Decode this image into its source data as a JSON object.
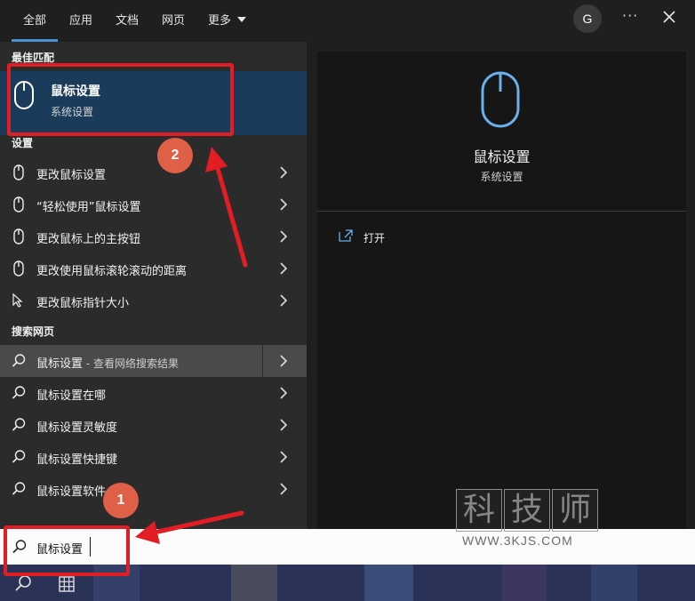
{
  "tabs": [
    {
      "label": "全部"
    },
    {
      "label": "应用"
    },
    {
      "label": "文档"
    },
    {
      "label": "网页"
    },
    {
      "label": "更多"
    }
  ],
  "user_avatar": "G",
  "more_menu": "···",
  "sections": {
    "best_match": "最佳匹配",
    "settings": "设置",
    "web": "搜索网页"
  },
  "best_match": {
    "title": "鼠标设置",
    "subtitle": "系统设置"
  },
  "settings_items": [
    {
      "label": "更改鼠标设置"
    },
    {
      "label": "“轻松使用”鼠标设置"
    },
    {
      "label": "更改鼠标上的主按钮"
    },
    {
      "label": "更改使用鼠标滚轮滚动的距离"
    },
    {
      "label": "更改鼠标指针大小"
    }
  ],
  "web_items": [
    {
      "label": "鼠标设置",
      "hint": " - 查看网络搜索结果"
    },
    {
      "label": "鼠标设置在哪"
    },
    {
      "label": "鼠标设置灵敏度"
    },
    {
      "label": "鼠标设置快捷键"
    },
    {
      "label": "鼠标设置软件"
    }
  ],
  "detail": {
    "title": "鼠标设置",
    "subtitle": "系统设置",
    "open_label": "打开"
  },
  "search": {
    "value": "鼠标设置"
  },
  "annotations": {
    "badge1": "1",
    "badge2": "2"
  },
  "watermark": {
    "chars": [
      "科",
      "技",
      "师"
    ],
    "url": "WWW.3KJS.COM"
  },
  "colors": {
    "accent": "#4c8fd6",
    "selected": "#1b3b5a",
    "annotation_red": "#e01e24"
  }
}
